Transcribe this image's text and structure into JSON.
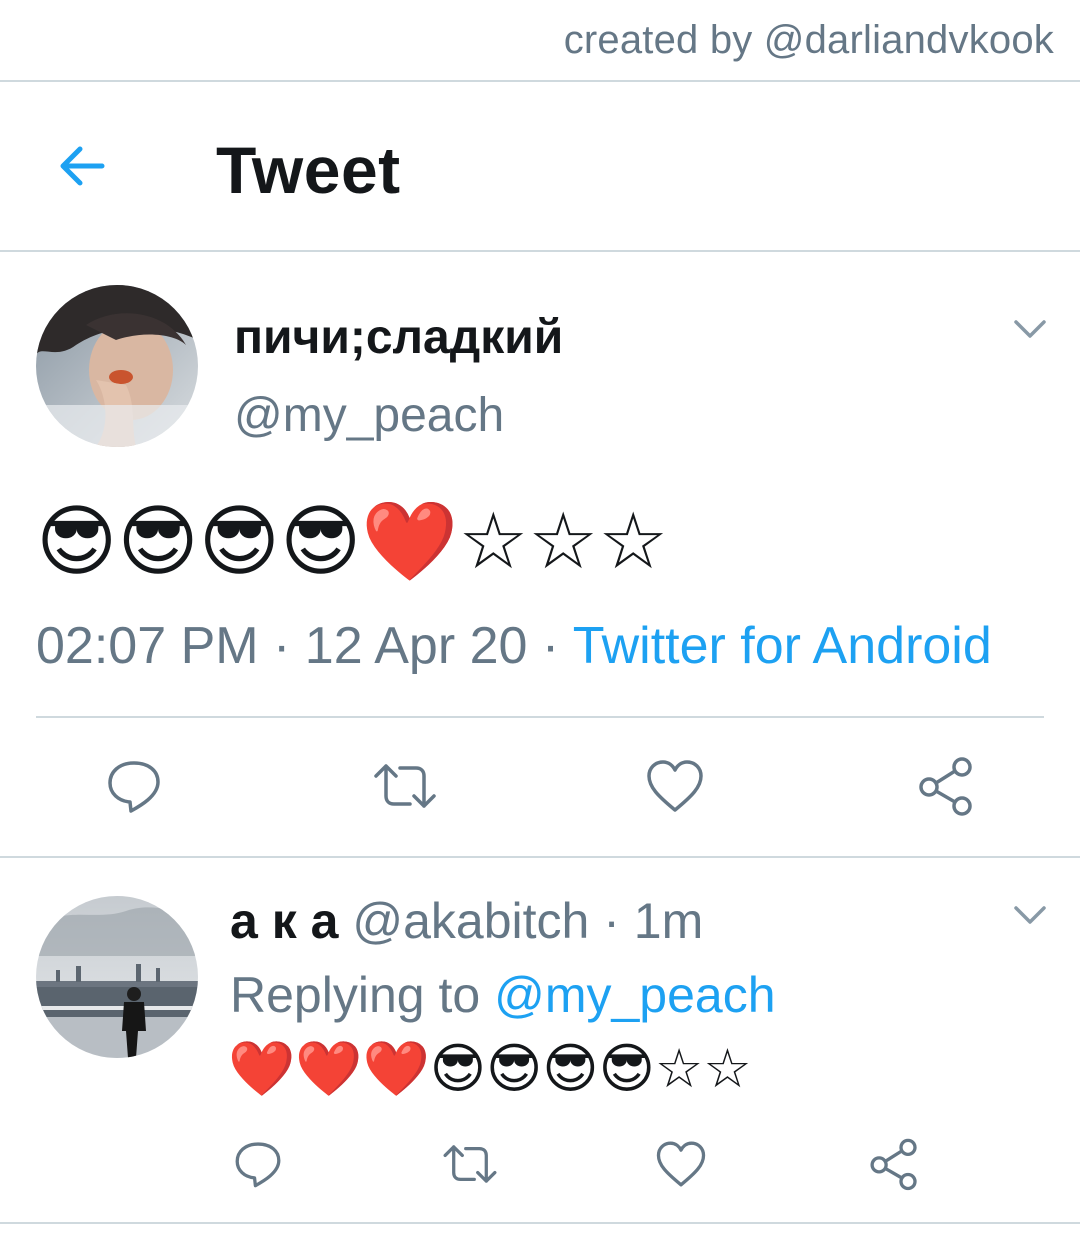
{
  "credit": "created by @darliandvkook",
  "header": {
    "title": "Tweet",
    "back_icon": "arrow-left-icon"
  },
  "tweet": {
    "display_name": "пичи;сладкий",
    "handle": "@my_peach",
    "text": "😎😎😎😎❤️☆☆☆",
    "time": "02:07 PM",
    "date": "12 Apr 20",
    "source": "Twitter for Android",
    "separator": " · "
  },
  "reply": {
    "display_name": "а к а",
    "handle": "@akabitch",
    "age": "· 1m",
    "replying_prefix": "Replying to",
    "replying_to": "@my_peach",
    "text": "❤️❤️❤️😎😎😎😎☆☆"
  },
  "icons": [
    "reply-icon",
    "retweet-icon",
    "like-icon",
    "share-icon",
    "chevron-down-icon"
  ],
  "colors": {
    "accent": "#1da1f2",
    "secondary_text": "#657786",
    "icon_gray": "#657786",
    "divider": "#cfd9de"
  }
}
